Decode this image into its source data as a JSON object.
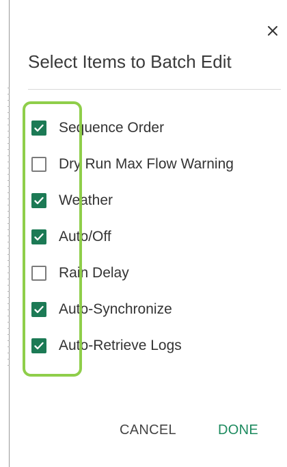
{
  "dialog": {
    "title": "Select Items to Batch Edit",
    "close_glyph": "×",
    "items": [
      {
        "label": "Sequence Order",
        "checked": true
      },
      {
        "label": "Dry Run Max Flow Warning",
        "checked": false
      },
      {
        "label": "Weather",
        "checked": true
      },
      {
        "label": "Auto/Off",
        "checked": true
      },
      {
        "label": "Rain Delay",
        "checked": false
      },
      {
        "label": "Auto-Synchronize",
        "checked": true
      },
      {
        "label": "Auto-Retrieve Logs",
        "checked": true
      }
    ],
    "cancel_label": "CANCEL",
    "done_label": "DONE"
  },
  "colors": {
    "accent": "#1c7a55",
    "done_text": "#1c8a5e",
    "highlight": "#8fce4a"
  },
  "icons": {
    "close": "close-icon",
    "checkmark": "checkmark-icon"
  }
}
